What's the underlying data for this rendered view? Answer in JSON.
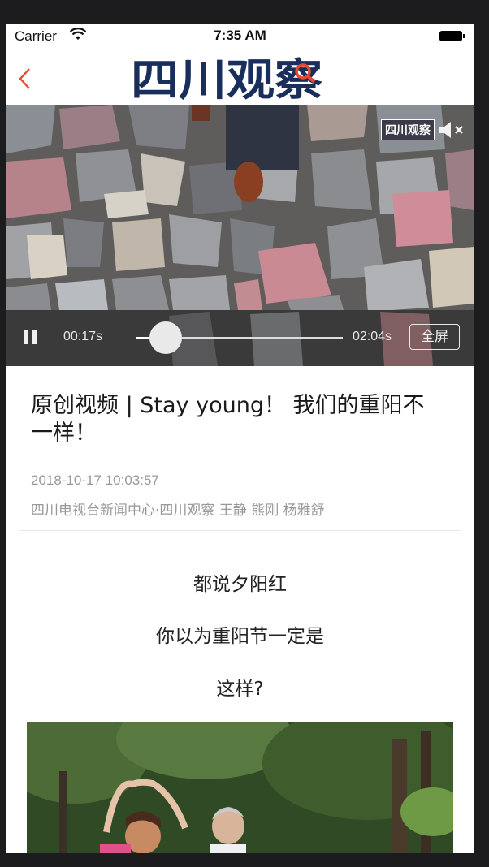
{
  "status_bar": {
    "carrier": "Carrier",
    "time": "7:35 AM"
  },
  "nav": {
    "logo_text": "四川观察"
  },
  "video": {
    "watermark": "四川观察",
    "elapsed": "00:17s",
    "total": "02:04s",
    "progress": 0.14,
    "fullscreen_label": "全屏"
  },
  "article": {
    "title": "原创视频 | Stay young！ 我们的重阳不一样！",
    "date": "2018-10-17 10:03:57",
    "byline": "四川电视台新闻中心·四川观察  王静 熊刚 杨雅舒",
    "paragraphs": [
      "都说夕阳红",
      "你以为重阳节一定是",
      "这样?"
    ]
  },
  "colors": {
    "accent": "#e8492f",
    "logo_navy": "#1a2e5c",
    "meta_gray": "#999999"
  }
}
